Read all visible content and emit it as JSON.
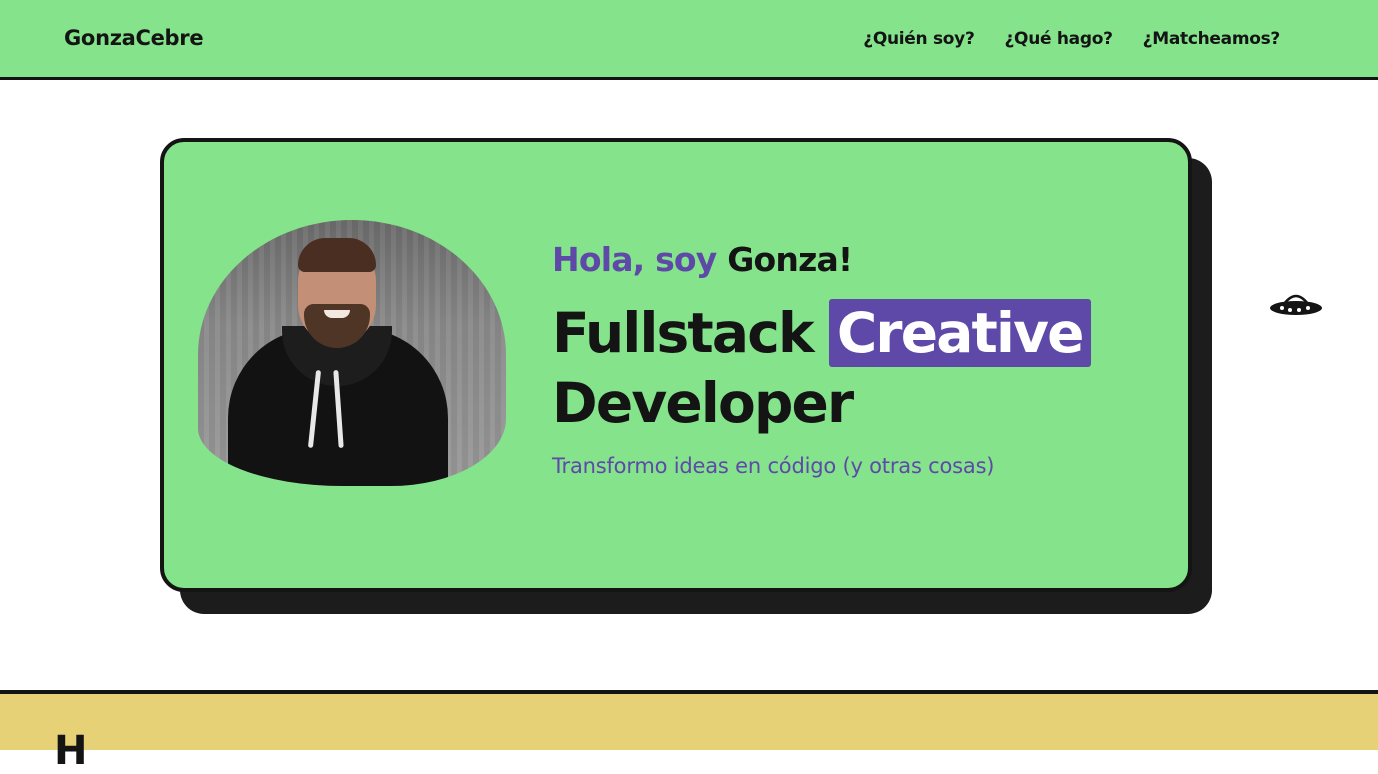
{
  "brand": "GonzaCebre",
  "nav": {
    "items": [
      "¿Quién soy?",
      "¿Qué hago?",
      "¿Matcheamos?"
    ]
  },
  "hero": {
    "greeting_prefix": "Hola, soy",
    "greeting_name": "Gonza!",
    "headline_word1": "Fullstack",
    "headline_highlight": "Creative",
    "headline_word2": "Developer",
    "subtitle": "Transformo ideas en código (y otras cosas)"
  },
  "next_section": {
    "title_partial": "H"
  },
  "icons": {
    "decoration": "ufo-icon"
  },
  "colors": {
    "green": "#84e38b",
    "purple": "#5e49a8",
    "dark": "#141414",
    "yellow": "#e7d177"
  }
}
